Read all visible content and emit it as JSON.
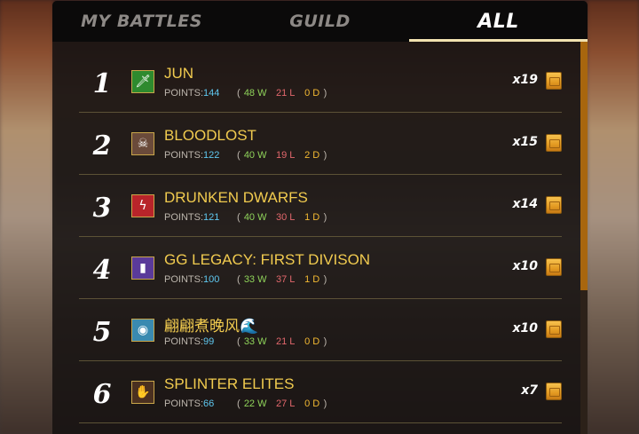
{
  "tabs": [
    {
      "label": "MY BATTLES",
      "active": false
    },
    {
      "label": "GUILD",
      "active": false
    },
    {
      "label": "ALL",
      "active": true
    }
  ],
  "stats_labels": {
    "points": "POINTS:",
    "win_suffix": "W",
    "loss_suffix": "L",
    "draw_suffix": "D"
  },
  "rows": [
    {
      "rank": "1",
      "name": "JUN",
      "points": "144",
      "wins": "48",
      "losses": "21",
      "draws": "0",
      "count": "x19",
      "emblem_icon": "sword-icon",
      "emblem_color": "#2e8a2e"
    },
    {
      "rank": "2",
      "name": "BLOODLOST",
      "points": "122",
      "wins": "40",
      "losses": "19",
      "draws": "2",
      "count": "x15",
      "emblem_icon": "skull-icon",
      "emblem_color": "#6a4a3a"
    },
    {
      "rank": "3",
      "name": "DRUNKEN DWARFS",
      "points": "121",
      "wins": "40",
      "losses": "30",
      "draws": "1",
      "count": "x14",
      "emblem_icon": "lightning-icon",
      "emblem_color": "#b8242a"
    },
    {
      "rank": "4",
      "name": "GG LEGACY: FIRST DIVISON",
      "points": "100",
      "wins": "33",
      "losses": "37",
      "draws": "1",
      "count": "x10",
      "emblem_icon": "book-icon",
      "emblem_color": "#5a3a9a"
    },
    {
      "rank": "5",
      "name": "翩翩煮晚风🌊",
      "points": "99",
      "wins": "33",
      "losses": "21",
      "draws": "0",
      "count": "x10",
      "emblem_icon": "orb-icon",
      "emblem_color": "#3a8ab0"
    },
    {
      "rank": "6",
      "name": "SPLINTER ELITES",
      "points": "66",
      "wins": "22",
      "losses": "27",
      "draws": "0",
      "count": "x7",
      "emblem_icon": "hand-icon",
      "emblem_color": "#4a3020"
    }
  ]
}
